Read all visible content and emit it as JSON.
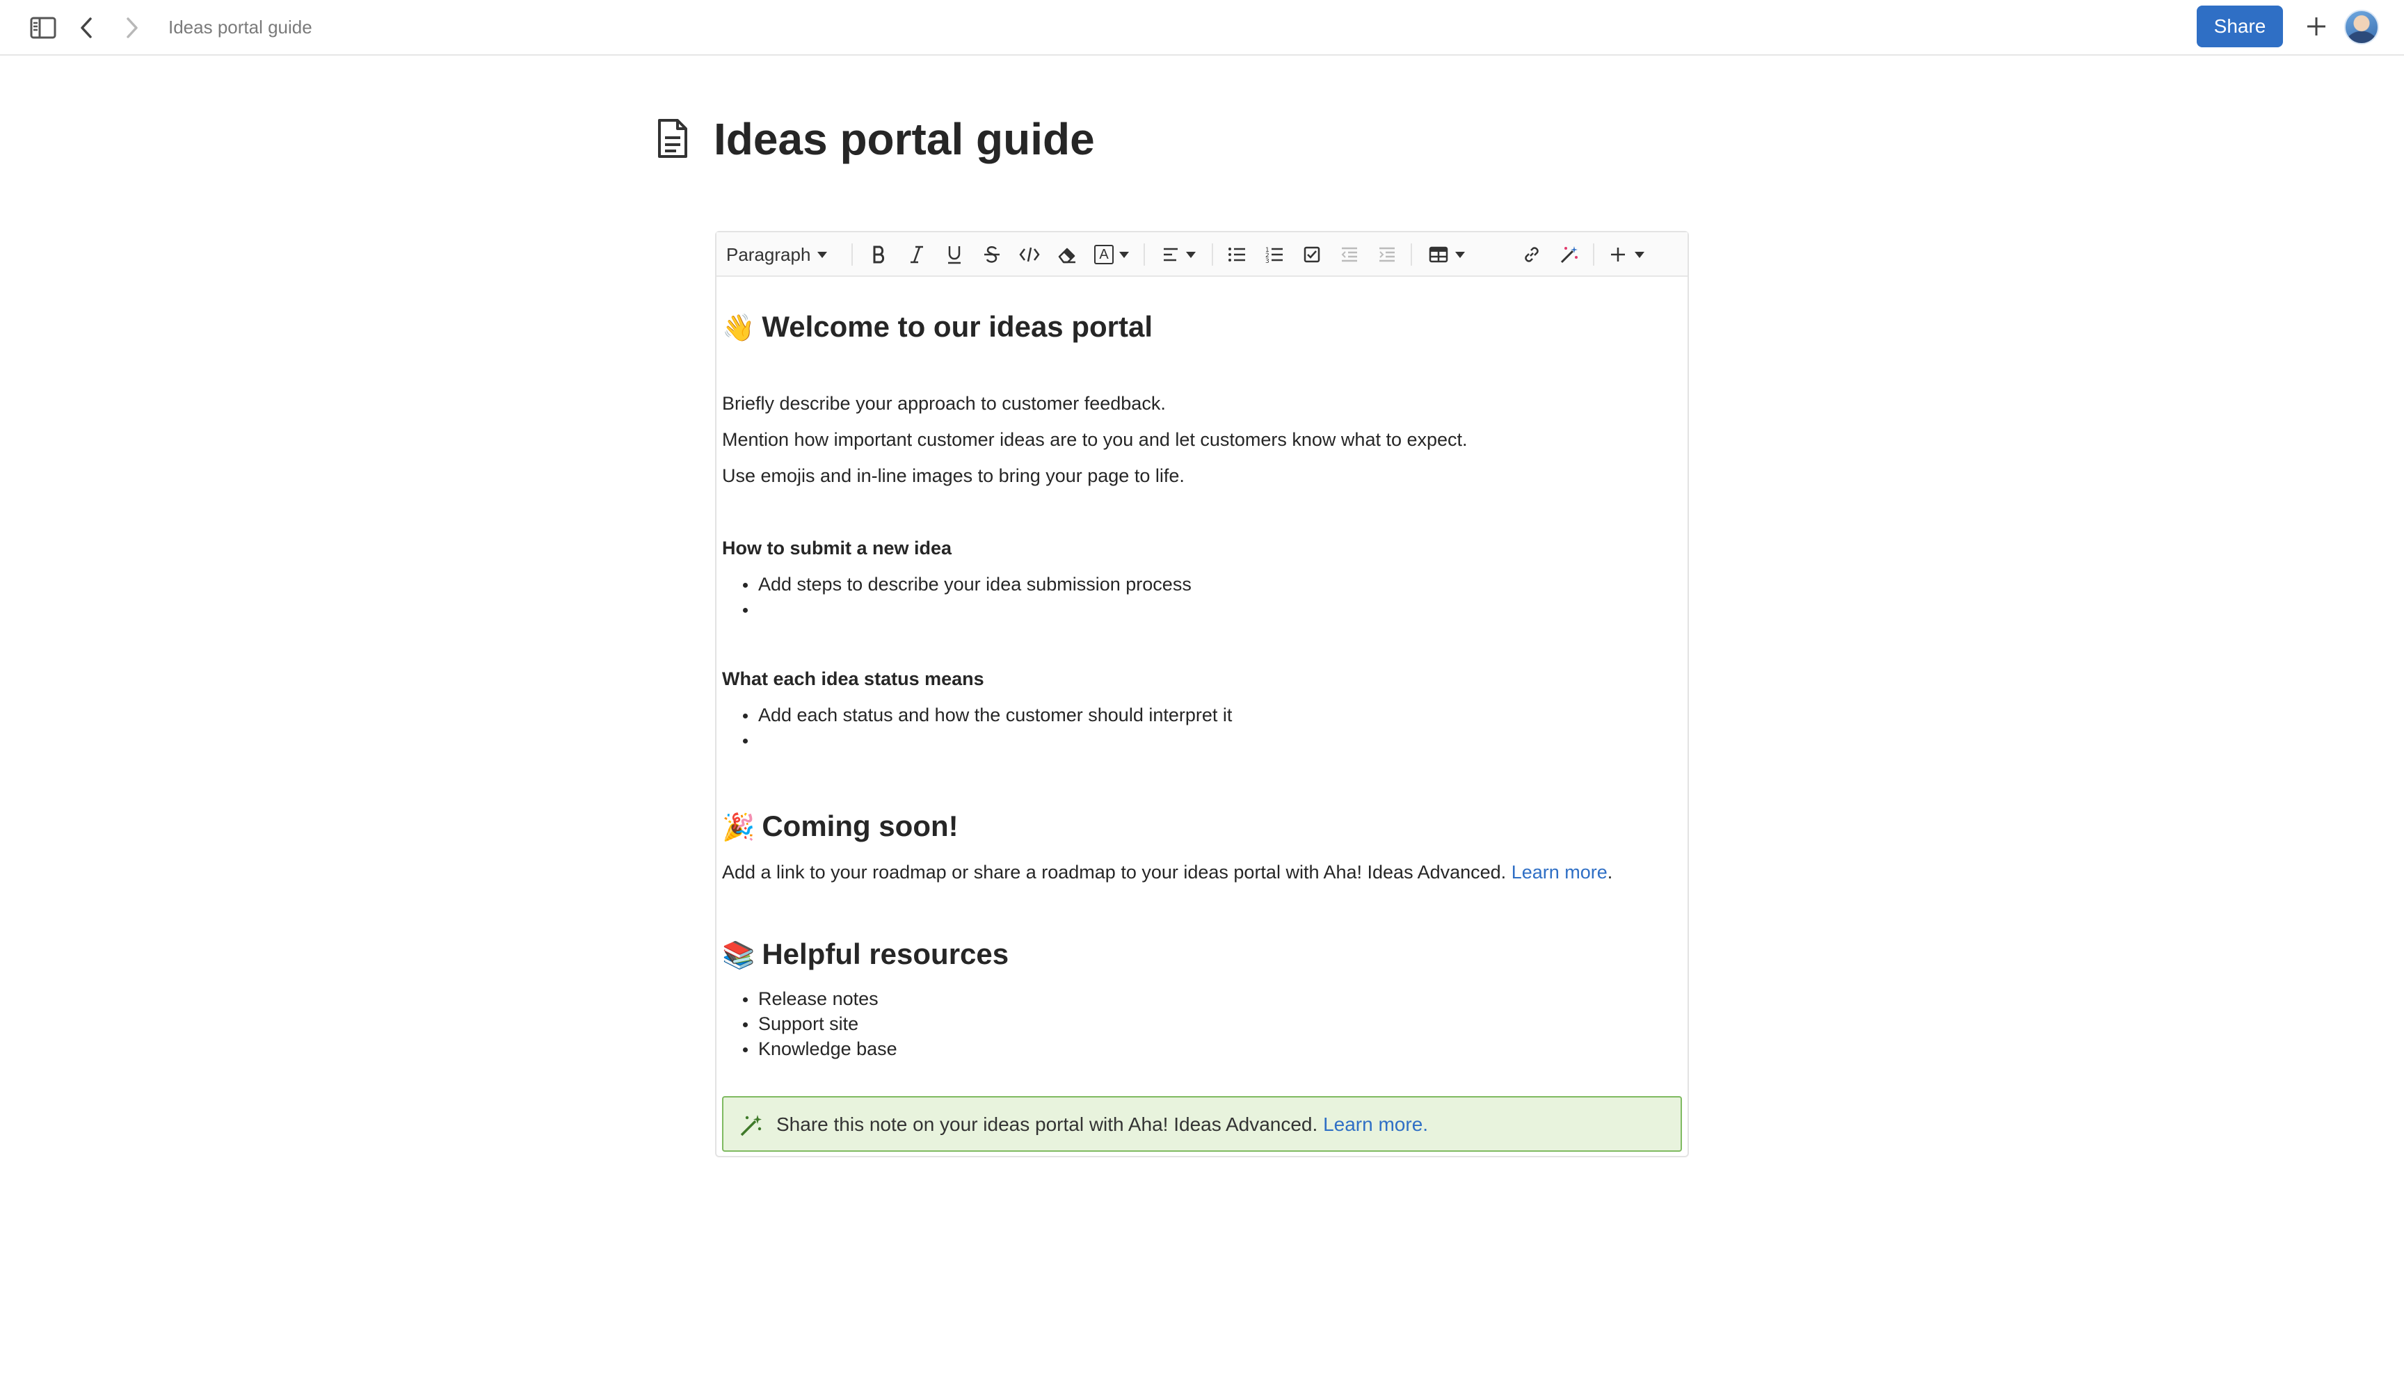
{
  "topbar": {
    "breadcrumb": "Ideas portal guide",
    "share_label": "Share",
    "icons": [
      "sidebar-toggle-icon",
      "back-arrow-icon",
      "forward-arrow-icon",
      "plus-icon",
      "avatar"
    ]
  },
  "document": {
    "title": "Ideas portal guide",
    "icon": "document-icon"
  },
  "toolbar": {
    "block_style": "Paragraph",
    "tools": [
      "bold-icon",
      "italic-icon",
      "underline-icon",
      "strikethrough-icon",
      "code-icon",
      "eraser-icon",
      "text-color-icon",
      "align-icon",
      "bulleted-list-icon",
      "numbered-list-icon",
      "checklist-icon",
      "outdent-icon",
      "indent-icon",
      "table-icon",
      "link-icon",
      "magic-wand-icon",
      "insert-plus-icon"
    ],
    "text_color_label": "A"
  },
  "content": {
    "welcome": {
      "emoji": "👋",
      "heading": "Welcome to our ideas portal"
    },
    "intro": [
      "Briefly describe your approach to customer feedback.",
      "Mention how important customer ideas are to you and let customers know what to expect.",
      "Use emojis and in-line images to bring your page to life."
    ],
    "submit": {
      "heading": "How to submit a new idea",
      "items": [
        "Add steps to describe your idea submission process",
        ""
      ]
    },
    "status": {
      "heading": "What each idea status means",
      "items": [
        "Add each status and how the customer should interpret it",
        ""
      ]
    },
    "coming_soon": {
      "emoji": "🎉",
      "heading": "Coming soon!",
      "text": "Add a link to your roadmap or share a roadmap to your ideas portal with Aha! Ideas Advanced.",
      "link": "Learn more",
      "after_link": "."
    },
    "resources": {
      "emoji": "📚",
      "heading": "Helpful resources",
      "items": [
        "Release notes",
        "Support site",
        "Knowledge base"
      ]
    }
  },
  "banner": {
    "icon": "magic-wand-icon",
    "text": "Share this note on your ideas portal with Aha! Ideas Advanced.",
    "link": "Learn more."
  },
  "colors": {
    "accent": "#2f6fc5",
    "banner_bg": "#e8f3dd",
    "banner_border": "#7fba61"
  }
}
